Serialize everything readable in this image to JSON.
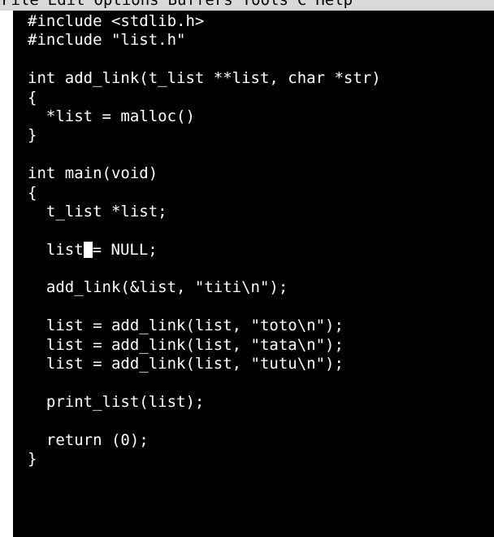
{
  "menubar": {
    "items": [
      {
        "label": "File"
      },
      {
        "label": "Edit"
      },
      {
        "label": "Options"
      },
      {
        "label": "Buffers"
      },
      {
        "label": "Tools"
      },
      {
        "label": "C"
      },
      {
        "label": "Help"
      }
    ]
  },
  "editor": {
    "lines": [
      "#include <stdlib.h>",
      "#include \"list.h\"",
      "",
      "int add_link(t_list **list, char *str)",
      "{",
      "  *list = malloc()",
      "}",
      "",
      "int main(void)",
      "{",
      "  t_list *list;",
      "",
      "  list",
      "",
      "  add_link(&list, \"titi\\n\");",
      "",
      "  list = add_link(list, \"toto\\n\");",
      "  list = add_link(list, \"tata\\n\");",
      "  list = add_link(list, \"tutu\\n\");",
      "",
      "  print_list(list);",
      "",
      "  return (0);",
      "}"
    ],
    "cursor_line_after": "= NULL;"
  },
  "colors": {
    "menubar_bg": "#d9d9d9",
    "editor_bg": "#000000",
    "text": "#ffffff",
    "cursor": "#ffffff"
  }
}
